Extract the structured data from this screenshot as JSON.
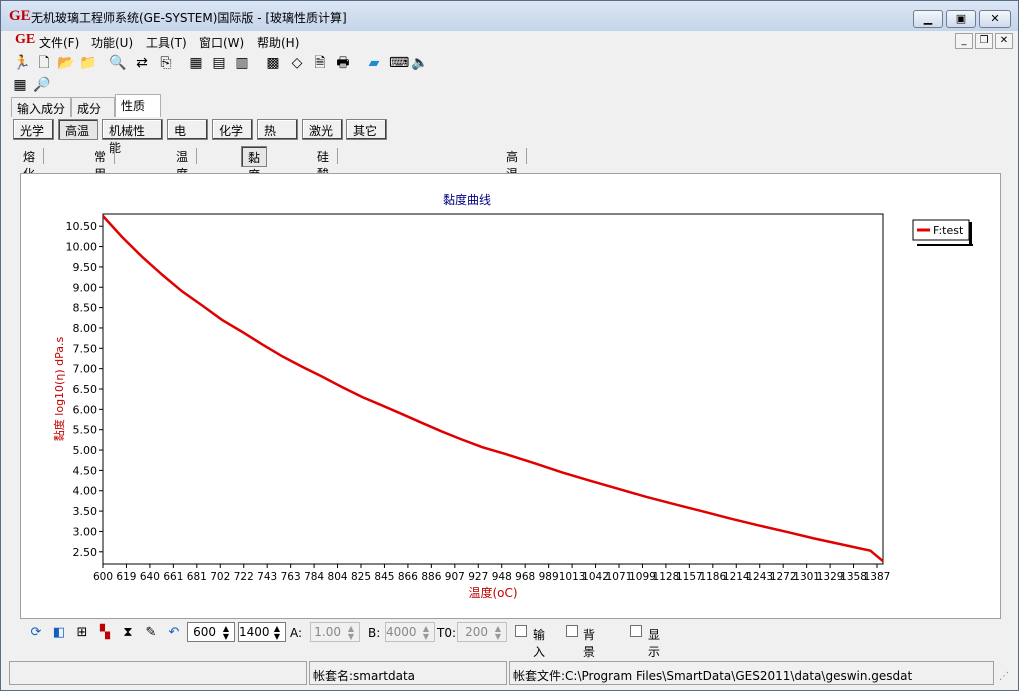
{
  "window": {
    "logo": "GE",
    "title": "无机玻璃工程师系统(GE-SYSTEM)国际版 - [玻璃性质计算]"
  },
  "menu": {
    "logo": "GE",
    "items": [
      "文件(F)",
      "功能(U)",
      "工具(T)",
      "窗口(W)",
      "帮助(H)"
    ]
  },
  "tabs_main": [
    "输入成分",
    "成分",
    "性质"
  ],
  "tabs_category": [
    "光学",
    "高温",
    "机械性能",
    "电",
    "化学",
    "热",
    "激光",
    "其它"
  ],
  "tabs_sub": [
    "熔化相关",
    "常用温度点",
    "温度范围",
    "黏度曲线",
    "硅酸盐玻璃高温密度和膨胀系数",
    "高温电阻"
  ],
  "chart_data": {
    "type": "line",
    "title": "黏度曲线",
    "xlabel": "温度(oC)",
    "ylabel": "黏度 log10(η) dPa.s",
    "x_ticks": [
      "600",
      "619",
      "640",
      "661",
      "681",
      "702",
      "722",
      "743",
      "763",
      "784",
      "804",
      "825",
      "845",
      "866",
      "886",
      "907",
      "927",
      "948",
      "968",
      "989",
      "1013",
      "1042",
      "1071",
      "1099",
      "1128",
      "1157",
      "1186",
      "1214",
      "1243",
      "1272",
      "1301",
      "1329",
      "1358",
      "1387"
    ],
    "y_ticks": [
      "10.50",
      "10.00",
      "9.50",
      "9.00",
      "8.50",
      "8.00",
      "7.50",
      "7.00",
      "6.50",
      "6.00",
      "5.50",
      "5.00",
      "4.50",
      "4.00",
      "3.50",
      "3.00",
      "2.50"
    ],
    "ylim": [
      2.2,
      10.8
    ],
    "series": [
      {
        "name": "F:test",
        "color": "#e00000",
        "x": [
          600,
          619,
          640,
          661,
          681,
          702,
          722,
          743,
          763,
          784,
          804,
          825,
          845,
          866,
          886,
          907,
          927,
          948,
          968,
          989,
          1013,
          1042,
          1071,
          1099,
          1128,
          1157,
          1186,
          1214,
          1243,
          1272,
          1301,
          1329,
          1358,
          1387,
          1400
        ],
        "y": [
          10.75,
          10.25,
          9.75,
          9.3,
          8.9,
          8.55,
          8.2,
          7.9,
          7.6,
          7.3,
          7.05,
          6.8,
          6.55,
          6.3,
          6.1,
          5.88,
          5.67,
          5.45,
          5.26,
          5.07,
          4.9,
          4.68,
          4.45,
          4.25,
          4.05,
          3.85,
          3.67,
          3.5,
          3.32,
          3.15,
          2.99,
          2.83,
          2.68,
          2.53,
          2.27
        ]
      }
    ],
    "legend_position": "right",
    "grid": false
  },
  "controls": {
    "from": "600",
    "to": "1400",
    "a_label": "A:",
    "a_value": "1.00",
    "b_label": "B:",
    "b_value": "4000",
    "t0_label": "T0:",
    "t0_value": "200",
    "chk_input": "输入",
    "chk_bg": "背景",
    "chk_showh": "显示H"
  },
  "status": {
    "account": "帐套名:smartdata",
    "file": "帐套文件:C:\\Program Files\\SmartData\\GES2011\\data\\geswin.gesdat"
  }
}
